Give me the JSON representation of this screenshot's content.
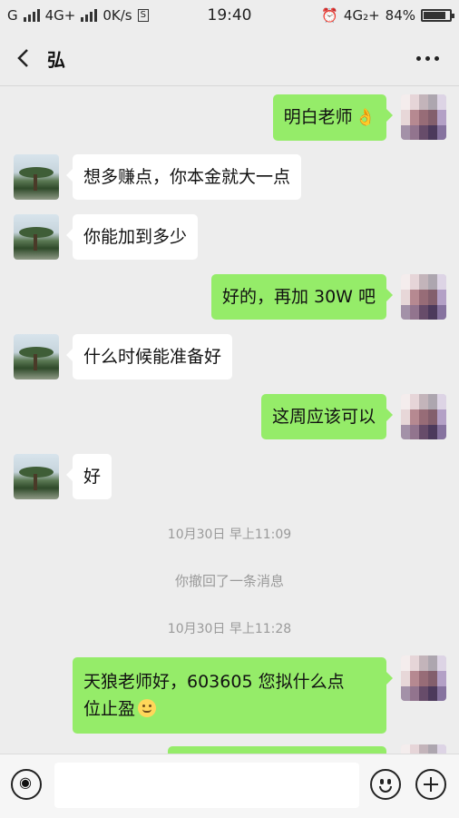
{
  "status_bar": {
    "carrier1": "G",
    "carrier2": "4G+",
    "speed": "0K/s",
    "s_badge": "S",
    "time": "19:40",
    "network": "4G₂+",
    "battery": "84%",
    "battery_level": 0.84
  },
  "header": {
    "title": "弘"
  },
  "messages": [
    {
      "side": "out",
      "text": "明白老师",
      "emoji": "clap-icon"
    },
    {
      "side": "in",
      "text": "想多赚点，你本金就大一点"
    },
    {
      "side": "in",
      "text": "你能加到多少"
    },
    {
      "side": "out",
      "text": "好的，再加 30W 吧"
    },
    {
      "side": "in",
      "text": "什么时候能准备好"
    },
    {
      "side": "out",
      "text": "这周应该可以"
    },
    {
      "side": "in",
      "text": "好"
    },
    {
      "type": "time",
      "text": "10月30日 早上11:09"
    },
    {
      "type": "system",
      "text": "你撤回了一条消息"
    },
    {
      "type": "time",
      "text": "10月30日 早上11:28"
    },
    {
      "side": "out",
      "line1": "天狼老师好，603605 您拟什么点",
      "line2": "位止盈",
      "emoji": "smiley-icon"
    }
  ]
}
